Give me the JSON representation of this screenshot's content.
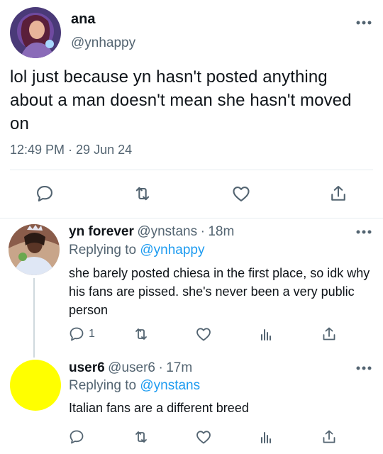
{
  "tweet": {
    "name": "ana",
    "handle": "@ynhappy",
    "text": "lol just because yn hasn't posted anything about a man doesn't mean she hasn't moved on",
    "timestamp": "12:49 PM · 29 Jun 24",
    "avatar_color": "#3a2a5e",
    "actions": [
      "reply-icon",
      "retweet-icon",
      "like-icon",
      "share-icon"
    ]
  },
  "replies": [
    {
      "name": "yn forever",
      "handle": "@ynstans",
      "time": "18m",
      "replying_label": "Replying to",
      "replying_to": "@ynhappy",
      "text": "she barely posted chiesa in the first place, so idk why his fans are pissed. she's never been a very public person",
      "reply_count": "1",
      "avatar_color": "#6b3f3a"
    },
    {
      "name": "user6",
      "handle": "@user6",
      "time": "17m",
      "replying_label": "Replying to",
      "replying_to": "@ynstans",
      "text": "Italian fans are a different breed",
      "avatar_color": "#ffff00"
    }
  ],
  "colors": {
    "accent": "#1d9bf0",
    "icon": "#536471",
    "divider": "#e6ecf0"
  }
}
